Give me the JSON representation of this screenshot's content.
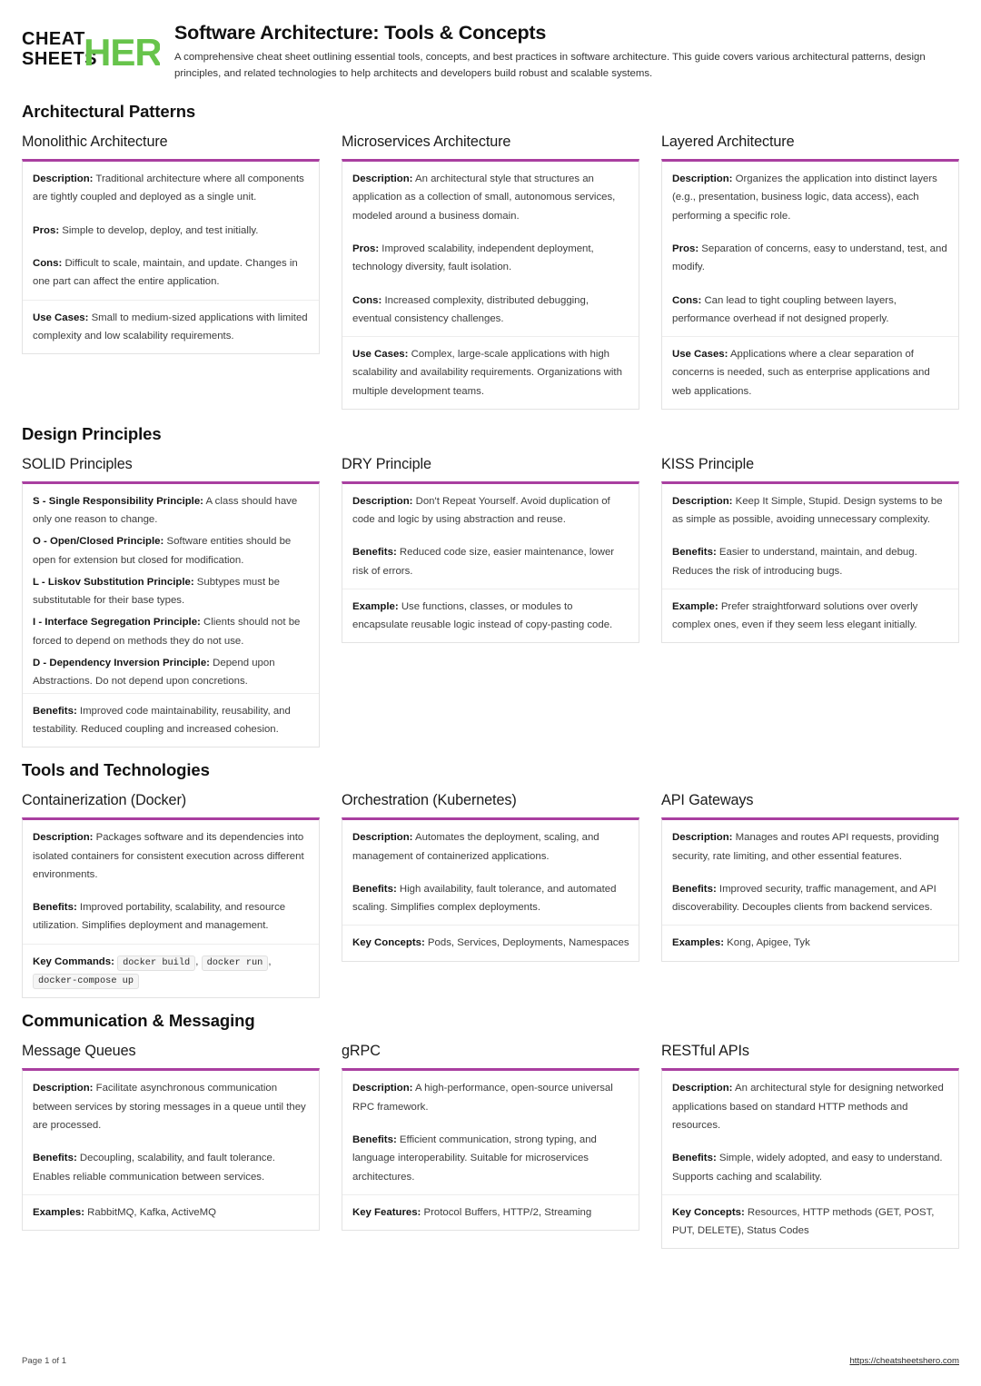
{
  "brand": {
    "line1": "CHEAT",
    "line2": "SHEETS",
    "hero": "HERO",
    "hero_color": "#67c44b",
    "text_color": "#111111"
  },
  "header": {
    "title": "Software Architecture: Tools & Concepts",
    "subtitle": "A comprehensive cheat sheet outlining essential tools, concepts, and best practices in software architecture. This guide covers various architectural patterns, design principles, and related technologies to help architects and developers build robust and scalable systems."
  },
  "theme": {
    "accent": "#a93fa0",
    "card_border": "#e3e3e3",
    "divider": "#ededed"
  },
  "sections": [
    {
      "title": "Architectural Patterns",
      "cards": [
        {
          "title": "Monolithic Architecture",
          "rows": [
            {
              "label": "Description:",
              "text": " Traditional architecture where all components are tightly coupled and deployed as a single unit."
            },
            {
              "label": "Pros:",
              "text": " Simple to develop, deploy, and test initially."
            },
            {
              "label": "Cons:",
              "text": " Difficult to scale, maintain, and update. Changes in one part can affect the entire application."
            },
            {
              "label": "Use Cases:",
              "text": " Small to medium-sized applications with limited complexity and low scalability requirements.",
              "divided": true
            }
          ]
        },
        {
          "title": "Microservices Architecture",
          "rows": [
            {
              "label": "Description:",
              "text": " An architectural style that structures an application as a collection of small, autonomous services, modeled around a business domain."
            },
            {
              "label": "Pros:",
              "text": " Improved scalability, independent deployment, technology diversity, fault isolation."
            },
            {
              "label": "Cons:",
              "text": " Increased complexity, distributed debugging, eventual consistency challenges."
            },
            {
              "label": "Use Cases:",
              "text": " Complex, large-scale applications with high scalability and availability requirements. Organizations with multiple development teams.",
              "divided": true
            }
          ]
        },
        {
          "title": "Layered Architecture",
          "rows": [
            {
              "label": "Description:",
              "text": " Organizes the application into distinct layers (e.g., presentation, business logic, data access), each performing a specific role."
            },
            {
              "label": "Pros:",
              "text": " Separation of concerns, easy to understand, test, and modify."
            },
            {
              "label": "Cons:",
              "text": " Can lead to tight coupling between layers, performance overhead if not designed properly."
            },
            {
              "label": "Use Cases:",
              "text": " Applications where a clear separation of concerns is needed, such as enterprise applications and web applications.",
              "divided": true
            }
          ]
        }
      ]
    },
    {
      "title": "Design Principles",
      "cards": [
        {
          "title": "SOLID Principles",
          "rows": [
            {
              "label": "S - Single Responsibility Principle:",
              "text": " A class should have only one reason to change.",
              "tight": true
            },
            {
              "label": "O - Open/Closed Principle:",
              "text": " Software entities should be open for extension but closed for modification.",
              "tight": true
            },
            {
              "label": "L - Liskov Substitution Principle:",
              "text": " Subtypes must be substitutable for their base types.",
              "tight": true
            },
            {
              "label": "I - Interface Segregation Principle:",
              "text": " Clients should not be forced to depend on methods they do not use.",
              "tight": true
            },
            {
              "label": "D - Dependency Inversion Principle:",
              "text": " Depend upon Abstractions. Do not depend upon concretions.",
              "tight": true
            },
            {
              "label": "Benefits:",
              "text": " Improved code maintainability, reusability, and testability. Reduced coupling and increased cohesion.",
              "divided": true
            }
          ]
        },
        {
          "title": "DRY Principle",
          "rows": [
            {
              "label": "Description:",
              "text": " Don't Repeat Yourself. Avoid duplication of code and logic by using abstraction and reuse."
            },
            {
              "label": "Benefits:",
              "text": " Reduced code size, easier maintenance, lower risk of errors."
            },
            {
              "label": "Example:",
              "text": " Use functions, classes, or modules to encapsulate reusable logic instead of copy-pasting code.",
              "divided": true
            }
          ]
        },
        {
          "title": "KISS Principle",
          "rows": [
            {
              "label": "Description:",
              "text": " Keep It Simple, Stupid. Design systems to be as simple as possible, avoiding unnecessary complexity."
            },
            {
              "label": "Benefits:",
              "text": " Easier to understand, maintain, and debug. Reduces the risk of introducing bugs."
            },
            {
              "label": "Example:",
              "text": " Prefer straightforward solutions over overly complex ones, even if they seem less elegant initially.",
              "divided": true
            }
          ]
        }
      ]
    },
    {
      "title": "Tools and Technologies",
      "cards": [
        {
          "title": "Containerization (Docker)",
          "rows": [
            {
              "label": "Description:",
              "text": " Packages software and its dependencies into isolated containers for consistent execution across different environments."
            },
            {
              "label": "Benefits:",
              "text": " Improved portability, scalability, and resource utilization. Simplifies deployment and management."
            },
            {
              "label": "Key Commands:",
              "text": " ",
              "divided": true,
              "codes": [
                "docker build",
                "docker run",
                "docker-compose up"
              ]
            }
          ]
        },
        {
          "title": "Orchestration (Kubernetes)",
          "rows": [
            {
              "label": "Description:",
              "text": " Automates the deployment, scaling, and management of containerized applications."
            },
            {
              "label": "Benefits:",
              "text": " High availability, fault tolerance, and automated scaling. Simplifies complex deployments."
            },
            {
              "label": "Key Concepts:",
              "text": " Pods, Services, Deployments, Namespaces",
              "divided": true
            }
          ]
        },
        {
          "title": "API Gateways",
          "rows": [
            {
              "label": "Description:",
              "text": " Manages and routes API requests, providing security, rate limiting, and other essential features."
            },
            {
              "label": "Benefits:",
              "text": " Improved security, traffic management, and API discoverability. Decouples clients from backend services."
            },
            {
              "label": "Examples:",
              "text": " Kong, Apigee, Tyk",
              "divided": true
            }
          ]
        }
      ]
    },
    {
      "title": "Communication & Messaging",
      "cards": [
        {
          "title": "Message Queues",
          "rows": [
            {
              "label": "Description:",
              "text": " Facilitate asynchronous communication between services by storing messages in a queue until they are processed."
            },
            {
              "label": "Benefits:",
              "text": " Decoupling, scalability, and fault tolerance. Enables reliable communication between services."
            },
            {
              "label": "Examples:",
              "text": " RabbitMQ, Kafka, ActiveMQ",
              "divided": true
            }
          ]
        },
        {
          "title": "gRPC",
          "rows": [
            {
              "label": "Description:",
              "text": " A high-performance, open-source universal RPC framework."
            },
            {
              "label": "Benefits:",
              "text": " Efficient communication, strong typing, and language interoperability. Suitable for microservices architectures."
            },
            {
              "label": "Key Features:",
              "text": " Protocol Buffers, HTTP/2, Streaming",
              "divided": true
            }
          ]
        },
        {
          "title": "RESTful APIs",
          "rows": [
            {
              "label": "Description:",
              "text": " An architectural style for designing networked applications based on standard HTTP methods and resources."
            },
            {
              "label": "Benefits:",
              "text": " Simple, widely adopted, and easy to understand. Supports caching and scalability."
            },
            {
              "label": "Key Concepts:",
              "text": " Resources, HTTP methods (GET, POST, PUT, DELETE), Status Codes",
              "divided": true
            }
          ]
        }
      ]
    }
  ],
  "footer": {
    "page": "Page 1 of 1",
    "url": "https://cheatsheetshero.com"
  }
}
